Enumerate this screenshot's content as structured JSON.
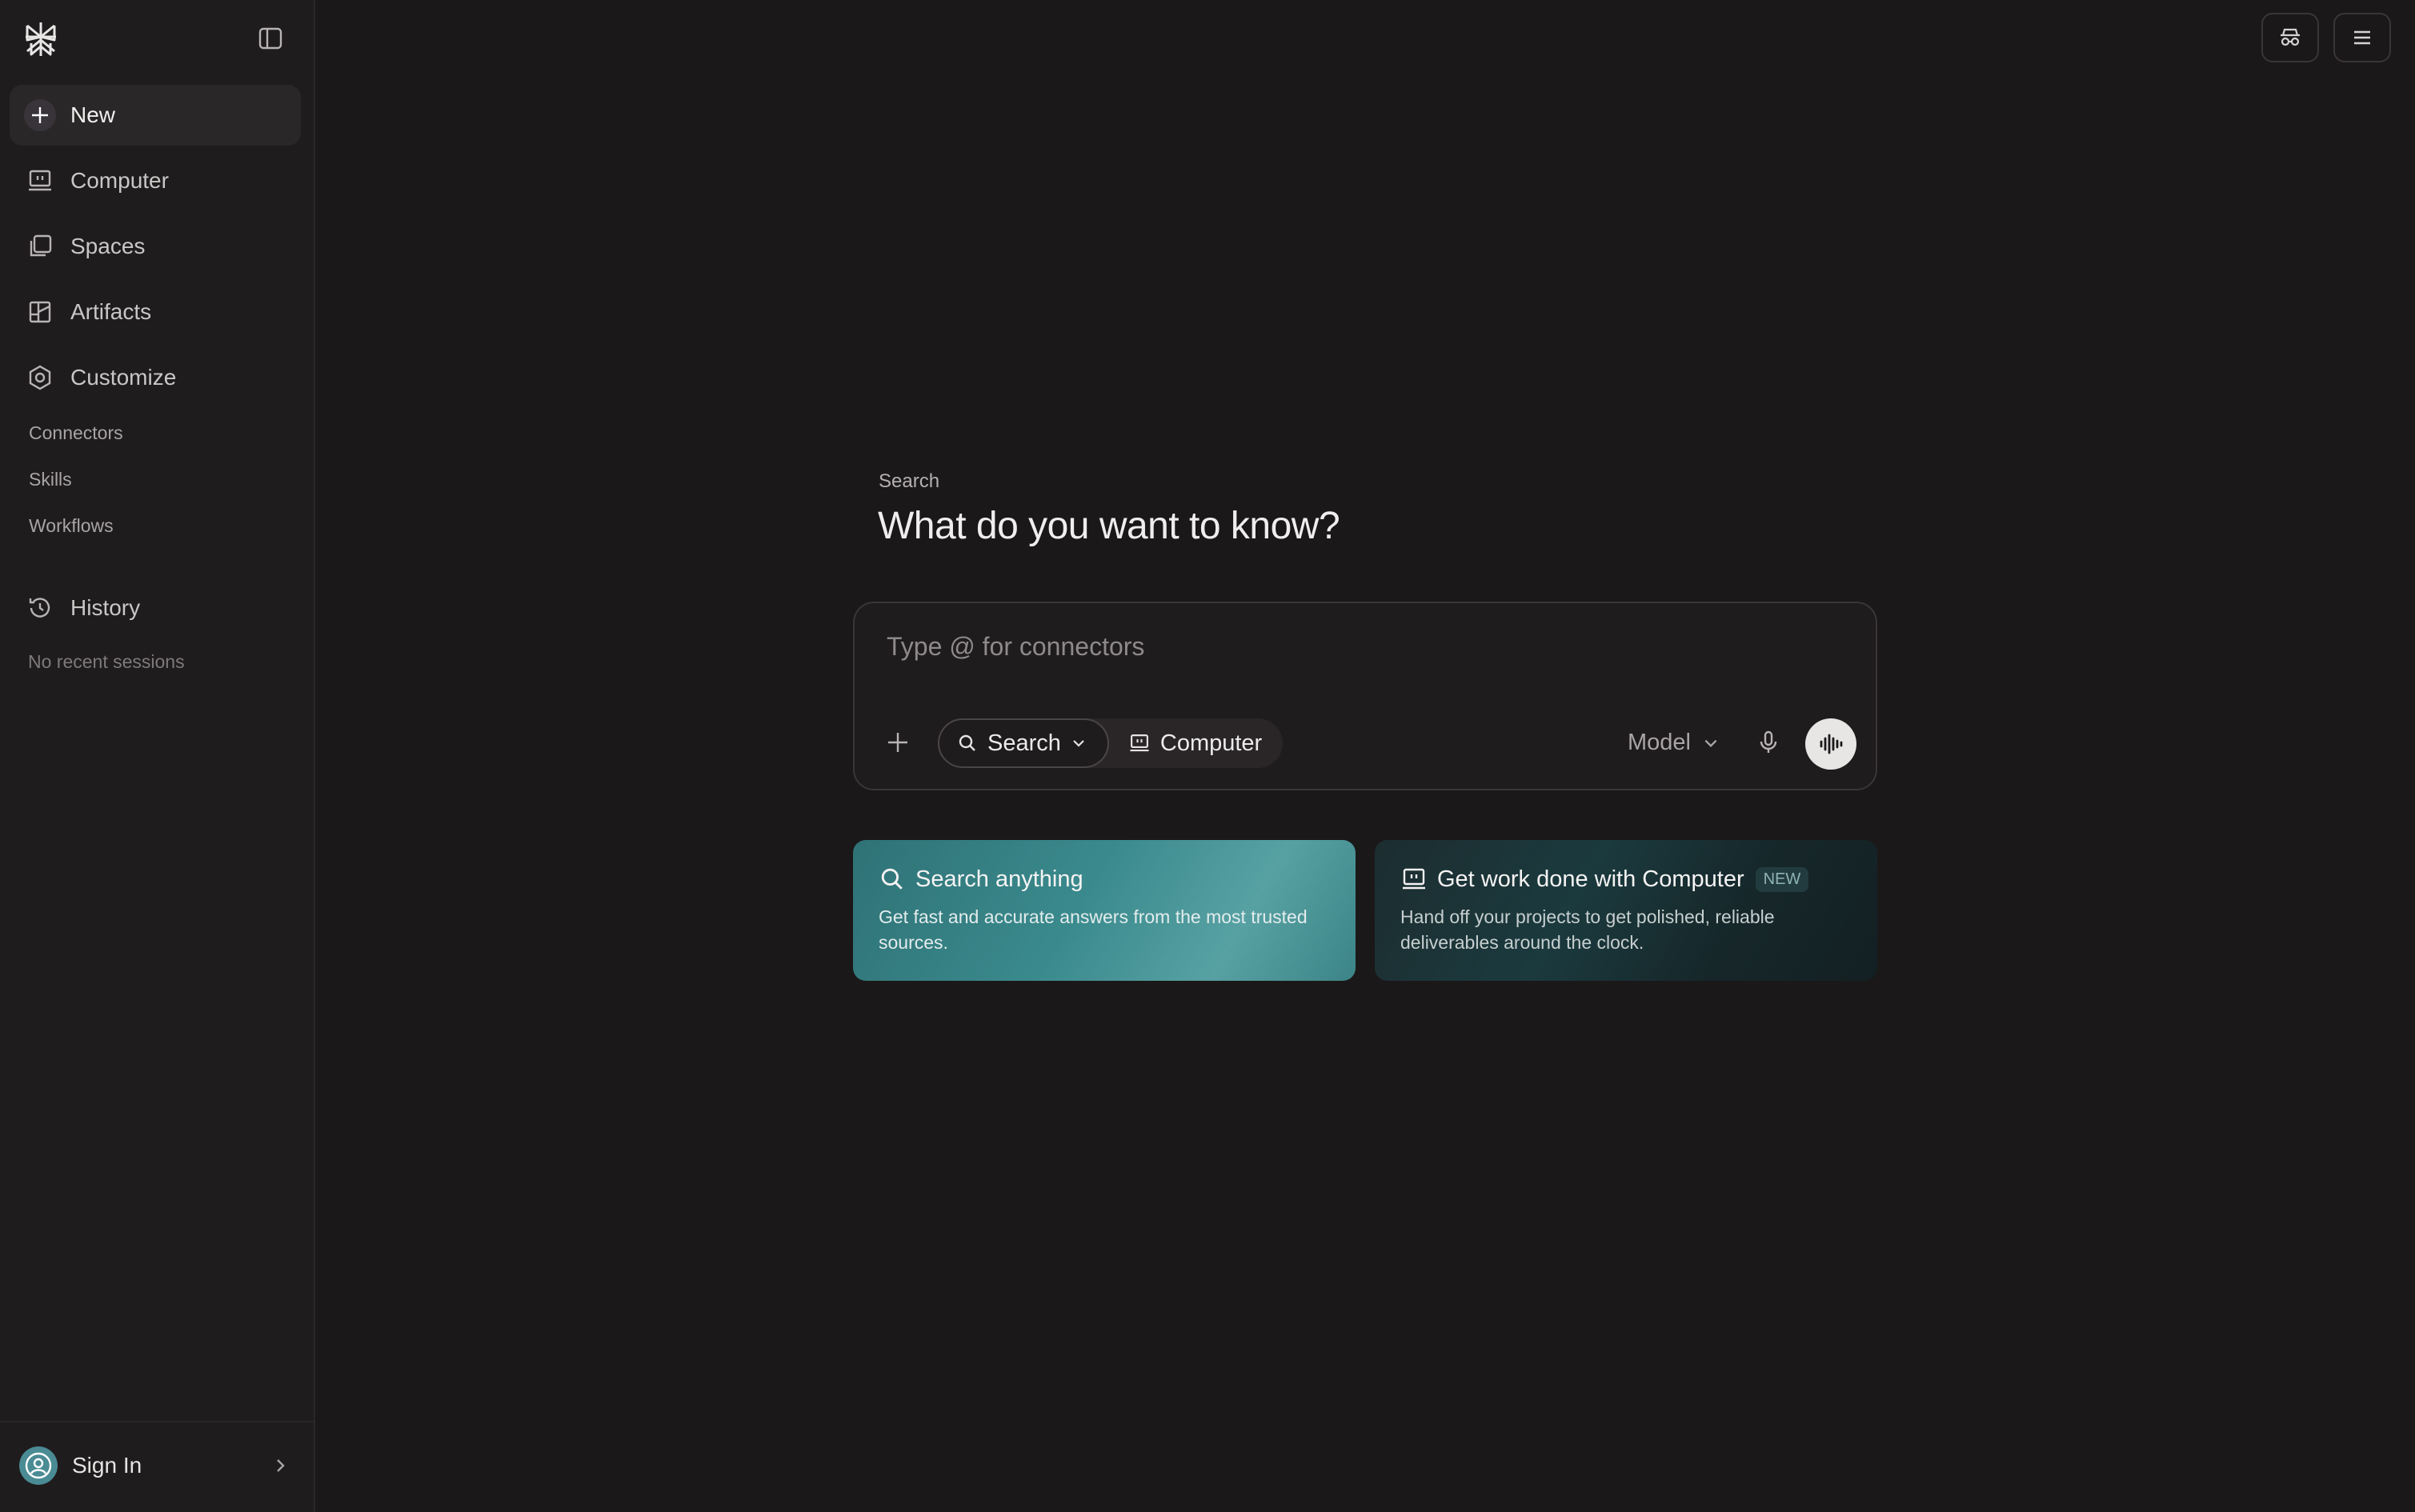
{
  "sidebar": {
    "logo_icon": "perplexity-logo",
    "collapse_icon": "sidebar-toggle-icon",
    "items": [
      {
        "label": "New",
        "icon": "plus-icon"
      },
      {
        "label": "Computer",
        "icon": "computer-icon"
      },
      {
        "label": "Spaces",
        "icon": "spaces-icon"
      },
      {
        "label": "Artifacts",
        "icon": "artifacts-icon"
      },
      {
        "label": "Customize",
        "icon": "customize-icon"
      }
    ],
    "customize_sub": [
      "Connectors",
      "Skills",
      "Workflows"
    ],
    "history": {
      "label": "History",
      "empty_text": "No recent sessions"
    },
    "account": {
      "label": "Sign In"
    }
  },
  "topbar": {
    "incognito_icon": "incognito-icon",
    "menu_icon": "menu-icon"
  },
  "main": {
    "kicker": "Search",
    "headline": "What do you want to know?",
    "composer": {
      "placeholder": "Type @ for connectors",
      "mode_search": "Search",
      "mode_computer": "Computer",
      "model_label": "Model"
    },
    "cards": [
      {
        "title": "Search anything",
        "description": "Get fast and accurate answers from the most trusted sources."
      },
      {
        "title": "Get work done with Computer",
        "badge": "NEW",
        "description": "Hand off your projects to get polished, reliable deliverables around the clock."
      }
    ]
  },
  "colors": {
    "background": "#1b1819",
    "sidebar": "#1f1c1d",
    "accent_teal": "#3a8a8d"
  }
}
